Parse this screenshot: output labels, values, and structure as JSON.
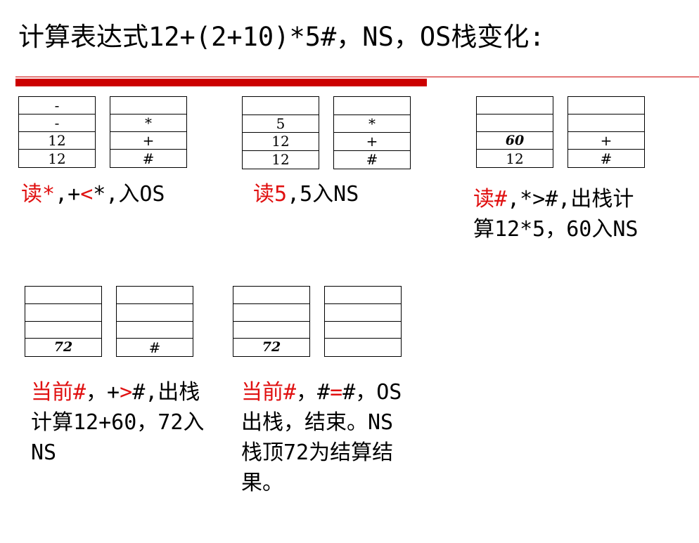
{
  "title": "计算表达式12+(2+10)*5#，NS，OS栈变化:",
  "stacks": {
    "s1": {
      "ns": [
        "-",
        "-",
        "12",
        "12"
      ],
      "os": [
        "",
        "*",
        "+",
        "#"
      ]
    },
    "s2": {
      "ns": [
        "",
        "5",
        "12",
        "12"
      ],
      "os": [
        "",
        "*",
        "+",
        "#"
      ]
    },
    "s3": {
      "ns": [
        "",
        "",
        "60",
        "12"
      ],
      "os": [
        "",
        "",
        "+",
        "#"
      ]
    },
    "s4": {
      "ns": [
        "",
        "",
        "",
        "72"
      ],
      "os": [
        "",
        "",
        "",
        "#"
      ]
    },
    "s5": {
      "ns": [
        "",
        "",
        "",
        "72"
      ],
      "os": [
        "",
        "",
        "",
        ""
      ]
    }
  },
  "captions": {
    "c1": {
      "red": "读*",
      "a": ",+",
      "red2": "<",
      "b": "*,入OS"
    },
    "c2": {
      "red": "读5",
      "a": ",5入NS"
    },
    "c3": {
      "red": "读#",
      "a": ",*>#,出栈计算12*5，60入NS"
    },
    "c4": {
      "red": "当前#",
      "a": "，+",
      "red2": ">",
      "b": "#,出栈计算12+60，72入NS"
    },
    "c5": {
      "red": "当前#",
      "a": "，#",
      "red2": "=",
      "b": "#，OS出栈，结束。NS栈顶72为结算结果。"
    }
  },
  "colors": {
    "accent": "#cc0000",
    "highlight": "#e01010"
  }
}
